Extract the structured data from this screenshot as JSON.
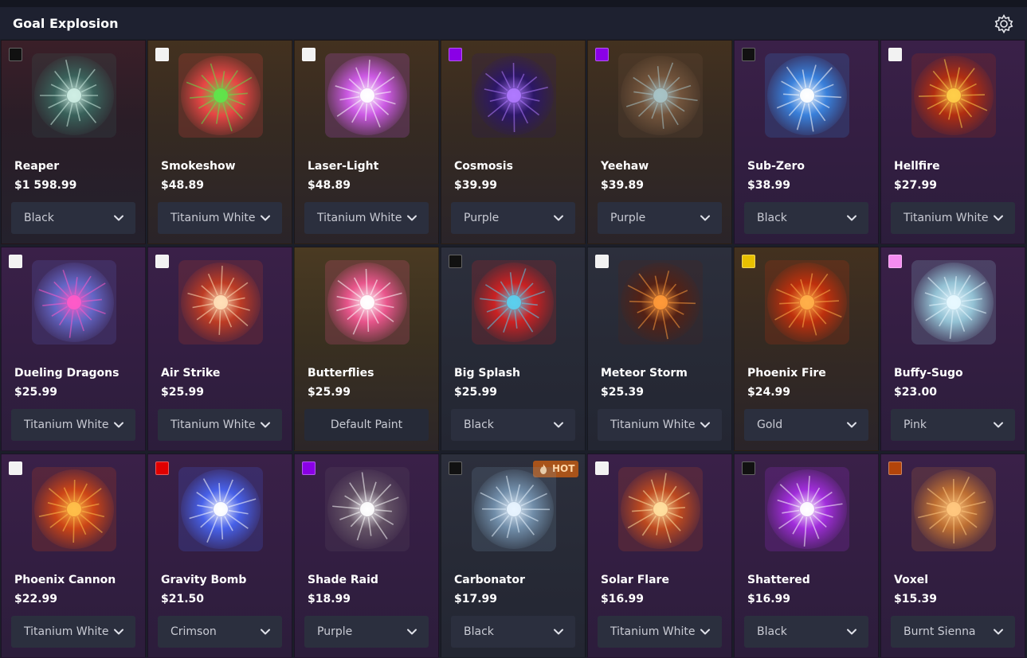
{
  "header": {
    "title": "Goal Explosion",
    "settings_icon": "gear-icon"
  },
  "colors": {
    "Black": "#111111",
    "Titanium White": "#f2f2f2",
    "Purple": "#8a00e6",
    "Gold": "#e8c000",
    "Pink": "#f58cf0",
    "Crimson": "#e00000",
    "Burnt Sienna": "#b3440a",
    "Default": "#ffffff"
  },
  "badges": {
    "hot_label": "HOT"
  },
  "items": [
    {
      "name": "Reaper",
      "price": "$1 598.99",
      "paint": "Black",
      "swatch": "Black",
      "rarity": "black",
      "art": "reaper-ghost-icon",
      "art_colors": [
        "#cfeee4",
        "#3b6b62"
      ]
    },
    {
      "name": "Smokeshow",
      "price": "$48.89",
      "paint": "Titanium White",
      "swatch": "Titanium White",
      "rarity": "orange",
      "art": "rainbow-smoke-icon",
      "art_colors": [
        "#5ee64a",
        "#ff4a4a"
      ]
    },
    {
      "name": "Laser-Light",
      "price": "$48.89",
      "paint": "Titanium White",
      "swatch": "Titanium White",
      "rarity": "orange",
      "art": "laser-burst-icon",
      "art_colors": [
        "#ffffff",
        "#e060ff"
      ]
    },
    {
      "name": "Cosmosis",
      "price": "$39.99",
      "paint": "Purple",
      "swatch": "Purple",
      "rarity": "orange",
      "art": "cosmic-burst-icon",
      "art_colors": [
        "#b07aff",
        "#2a1470"
      ]
    },
    {
      "name": "Yeehaw",
      "price": "$39.89",
      "paint": "Purple",
      "swatch": "Purple",
      "rarity": "orange",
      "art": "cowboy-hat-icon",
      "art_colors": [
        "#a7c4c8",
        "#7a5a40"
      ]
    },
    {
      "name": "Sub-Zero",
      "price": "$38.99",
      "paint": "Black",
      "swatch": "Black",
      "rarity": "purple",
      "art": "ice-burst-icon",
      "art_colors": [
        "#ffffff",
        "#3a8ef0"
      ]
    },
    {
      "name": "Hellfire",
      "price": "$27.99",
      "paint": "Titanium White",
      "swatch": "Titanium White",
      "rarity": "purple",
      "art": "flaming-skull-icon",
      "art_colors": [
        "#ffcf4a",
        "#c2300a"
      ]
    },
    {
      "name": "Dueling Dragons",
      "price": "$25.99",
      "paint": "Titanium White",
      "swatch": "Titanium White",
      "rarity": "purple",
      "art": "dragons-icon",
      "art_colors": [
        "#ff5ac8",
        "#6a70d8"
      ]
    },
    {
      "name": "Air Strike",
      "price": "$25.99",
      "paint": "Titanium White",
      "swatch": "Titanium White",
      "rarity": "purple",
      "art": "air-strike-explosion-icon",
      "art_colors": [
        "#ffe0b8",
        "#d04020"
      ]
    },
    {
      "name": "Butterflies",
      "price": "$25.99",
      "paint": "Default Paint",
      "swatch": "",
      "rarity": "gold",
      "art": "butterflies-flowers-icon",
      "art_colors": [
        "#ffffff",
        "#ff5a9a"
      ]
    },
    {
      "name": "Big Splash",
      "price": "$25.99",
      "paint": "Black",
      "swatch": "Black",
      "rarity": "slate",
      "art": "splash-text-icon",
      "art_colors": [
        "#5ad0f0",
        "#e02020"
      ]
    },
    {
      "name": "Meteor Storm",
      "price": "$25.39",
      "paint": "Titanium White",
      "swatch": "Titanium White",
      "rarity": "slate",
      "art": "meteor-storm-icon",
      "art_colors": [
        "#ff9a3a",
        "#5a2010"
      ]
    },
    {
      "name": "Phoenix Fire",
      "price": "$24.99",
      "paint": "Gold",
      "swatch": "Gold",
      "rarity": "orange",
      "art": "phoenix-icon",
      "art_colors": [
        "#ffb04a",
        "#d0300a"
      ]
    },
    {
      "name": "Buffy-Sugo",
      "price": "$23.00",
      "paint": "Pink",
      "swatch": "Pink",
      "rarity": "purple",
      "art": "buffy-sugo-icon",
      "art_colors": [
        "#e8f8ff",
        "#a0d8e8"
      ]
    },
    {
      "name": "Phoenix Cannon",
      "price": "$22.99",
      "paint": "Titanium White",
      "swatch": "Titanium White",
      "rarity": "purple",
      "art": "phoenix-cannon-icon",
      "art_colors": [
        "#ffc04a",
        "#e04a10"
      ]
    },
    {
      "name": "Gravity Bomb",
      "price": "$21.50",
      "paint": "Crimson",
      "swatch": "Crimson",
      "rarity": "purple",
      "art": "gravity-bomb-icon",
      "art_colors": [
        "#ffffff",
        "#4a6aff"
      ]
    },
    {
      "name": "Shade Raid",
      "price": "$18.99",
      "paint": "Purple",
      "swatch": "Purple",
      "rarity": "purple",
      "art": "shade-raid-icon",
      "art_colors": [
        "#ffffff",
        "#6a5a6a"
      ]
    },
    {
      "name": "Carbonator",
      "price": "$17.99",
      "paint": "Black",
      "swatch": "Black",
      "rarity": "slate",
      "art": "carbonator-bubbles-icon",
      "art_colors": [
        "#e8f4ff",
        "#7a9ab8"
      ],
      "hot": true
    },
    {
      "name": "Solar Flare",
      "price": "$16.99",
      "paint": "Titanium White",
      "swatch": "Titanium White",
      "rarity": "purple",
      "art": "solar-flare-icon",
      "art_colors": [
        "#ffe0a0",
        "#d0501a"
      ]
    },
    {
      "name": "Shattered",
      "price": "$16.99",
      "paint": "Black",
      "swatch": "Black",
      "rarity": "purple",
      "art": "shattered-burst-icon",
      "art_colors": [
        "#ffffff",
        "#b030f0"
      ]
    },
    {
      "name": "Voxel",
      "price": "$15.39",
      "paint": "Burnt Sienna",
      "swatch": "Burnt Sienna",
      "rarity": "purple",
      "art": "voxel-explosion-icon",
      "art_colors": [
        "#ffc880",
        "#d07a30"
      ]
    }
  ]
}
